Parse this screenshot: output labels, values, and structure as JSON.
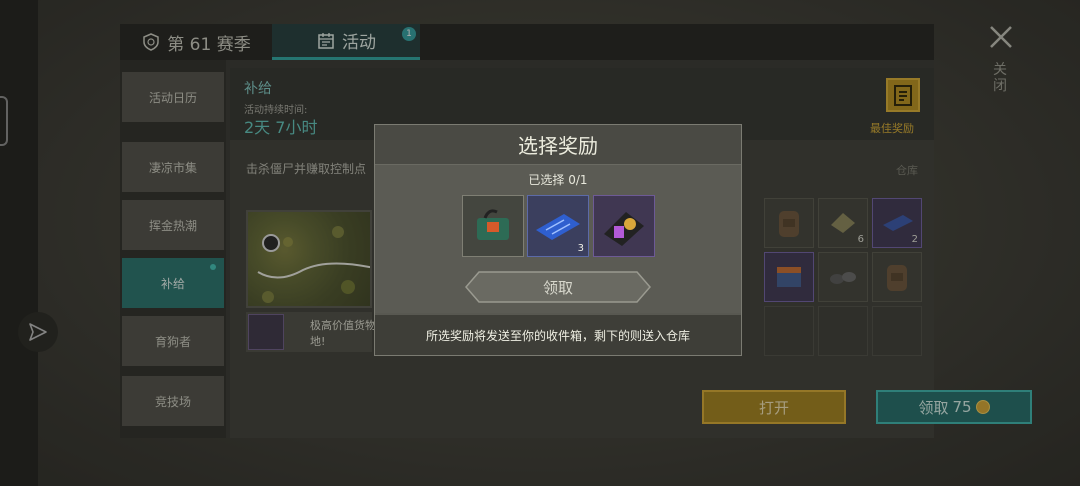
{
  "tabs": [
    {
      "label": "第 61 赛季",
      "icon": "shield-icon"
    },
    {
      "label": "活动",
      "icon": "calendar-icon",
      "badge": "1"
    }
  ],
  "close": {
    "label": "关闭"
  },
  "sidebar": {
    "items": [
      {
        "label": "活动日历"
      },
      {
        "label": "凄凉市集"
      },
      {
        "label": "挥金热潮"
      },
      {
        "label": "补给"
      },
      {
        "label": "育狗者"
      },
      {
        "label": "竞技场"
      }
    ],
    "active_index": 3
  },
  "header": {
    "title": "补给",
    "duration_label": "活动持续时间:",
    "duration_value": "2天 7小时",
    "best_reward_label": "最佳奖励"
  },
  "main": {
    "description": "击杀僵尸并赚取控制点",
    "item_text": "极高价值货物 地!",
    "storage_label": "仓库",
    "open_label": "打开",
    "claim_label": "领取",
    "claim_cost": "75"
  },
  "storage": {
    "cells": [
      {
        "icon": "backpack-icon",
        "count": ""
      },
      {
        "icon": "cloth-icon",
        "count": "6"
      },
      {
        "icon": "circuit-board-icon",
        "count": "2"
      },
      {
        "icon": "supply-box-icon",
        "count": ""
      },
      {
        "icon": "rocks-icon",
        "count": ""
      },
      {
        "icon": "backpack-icon",
        "count": ""
      }
    ]
  },
  "modal": {
    "title": "选择奖励",
    "selected_text": "已选择 0/1",
    "rewards": [
      {
        "icon": "battery-pack-icon",
        "count": ""
      },
      {
        "icon": "circuit-board-icon",
        "count": "3"
      },
      {
        "icon": "badge-wallet-icon",
        "count": ""
      }
    ],
    "claim_label": "领取",
    "footer": "所选奖励将发送至你的收件箱，剩下的则送入仓库"
  }
}
